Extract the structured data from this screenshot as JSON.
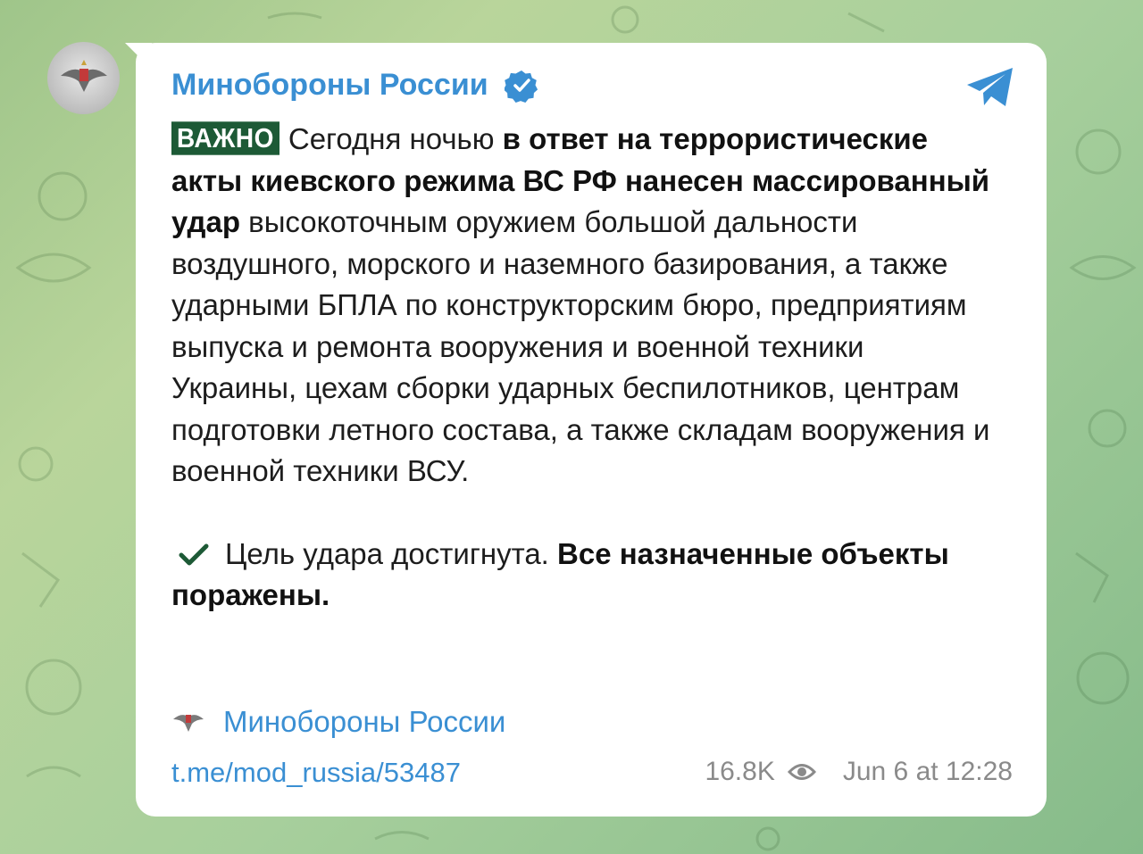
{
  "channel": {
    "name": "Минобороны России",
    "verified_icon": "verified-badge-icon",
    "app_icon": "telegram-icon",
    "avatar_icon": "mod-emblem-icon"
  },
  "message": {
    "badge": "ВАЖНО",
    "p1_regular_1": "Сегодня ночью ",
    "p1_bold_1": "в ответ на террористические акты киевского режима ВС РФ нанесен массированный удар",
    "p1_regular_2": " высокоточным оружием большой дальности воздушного, морского и наземного базирования, а также ударными БПЛА по конструкторским бюро, предприятиям выпуска и ремонта вооружения и военной техники Украины, цехам сборки ударных беспилотников, центрам подготовки летного состава, а также складам вооружения и военной техники ВСУ.",
    "p2_regular": "Цель удара достигнута. ",
    "p2_bold": "Все назначенные объекты поражены.",
    "check_icon": "checkmark-icon"
  },
  "signature": {
    "label": "Минобороны России",
    "icon": "mod-emblem-icon"
  },
  "footer": {
    "link": "t.me/mod_russia/53487",
    "views": "16.8K",
    "views_icon": "eye-icon",
    "date": "Jun 6 at 12:28"
  },
  "colors": {
    "accent": "#3a8fd3",
    "badge_bg": "#1d5a36",
    "check": "#1d5a36",
    "meta": "#8a8a8a"
  }
}
